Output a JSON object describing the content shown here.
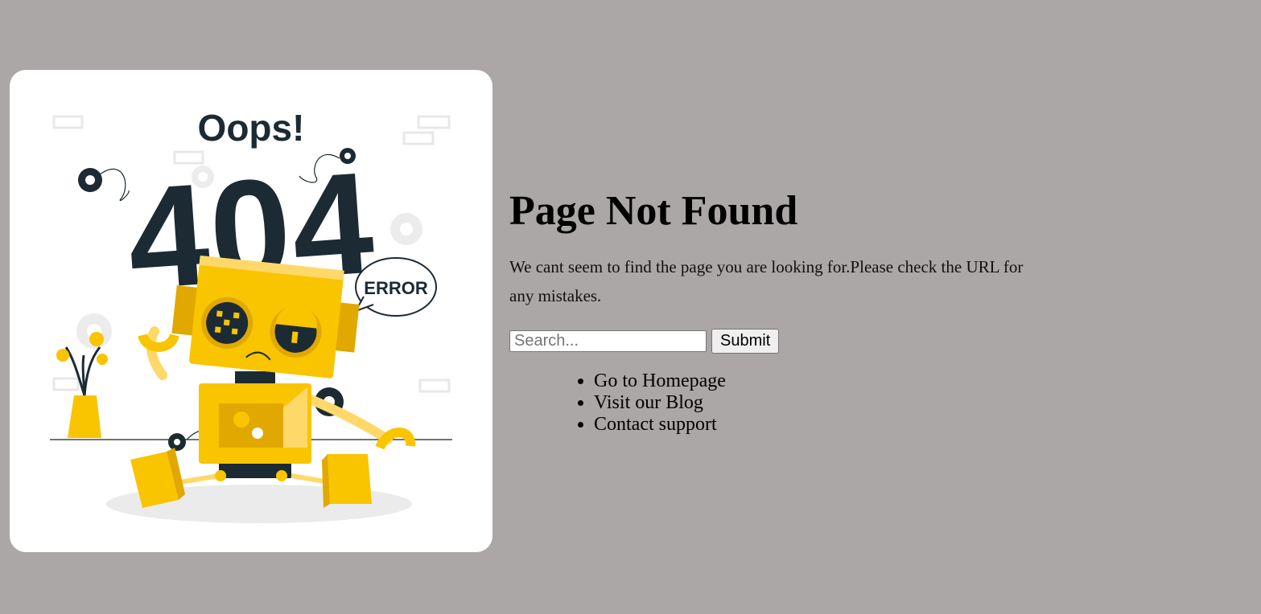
{
  "illustration": {
    "headline": "Oops!",
    "code": "404",
    "bubble_text": "ERROR"
  },
  "page": {
    "title": "Page Not Found",
    "description": "We cant seem to find the page you are looking for.Please check the URL for any mistakes."
  },
  "search": {
    "placeholder": "Search...",
    "value": "",
    "submit_label": "Submit"
  },
  "links": [
    {
      "label": "Go to Homepage"
    },
    {
      "label": "Visit our Blog"
    },
    {
      "label": "Contact support"
    }
  ],
  "colors": {
    "background": "#aaa7a6",
    "robot_yellow": "#f9c400",
    "robot_dark_yellow": "#e0a800",
    "ink": "#1c2a33"
  }
}
